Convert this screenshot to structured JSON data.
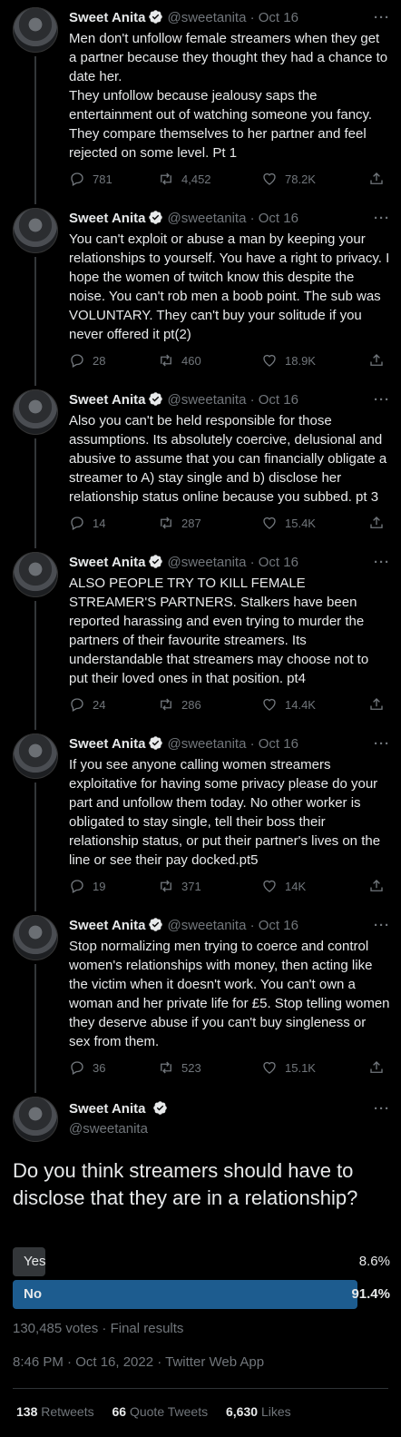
{
  "author": {
    "name": "Sweet Anita",
    "handle": "@sweetanita"
  },
  "colors": {
    "accent": "#1d9bf0",
    "poll_winner": "#1d5c8f",
    "poll_other": "#333639",
    "muted": "#71767b"
  },
  "tweets": [
    {
      "date": "· Oct 16",
      "text": "Men don't unfollow female streamers when they get a partner because they thought they had a chance to date her.\nThey unfollow because jealousy saps the entertainment out of watching someone you fancy. They compare themselves to her partner and feel rejected on some level. Pt 1",
      "replies": "781",
      "retweets": "4,452",
      "likes": "78.2K"
    },
    {
      "date": "· Oct 16",
      "text": "You can't exploit or abuse a man by keeping your relationships to yourself. You have a right to privacy. I hope the women of twitch know this despite the noise. You can't rob men a boob point. The sub was VOLUNTARY. They can't buy your solitude if you never offered it pt(2)",
      "replies": "28",
      "retweets": "460",
      "likes": "18.9K"
    },
    {
      "date": "· Oct 16",
      "text": "Also you can't be held responsible for those assumptions. Its absolutely coercive, delusional and abusive to assume that you can financially obligate a streamer to A) stay single and b) disclose her relationship status online because you subbed. pt 3",
      "replies": "14",
      "retweets": "287",
      "likes": "15.4K"
    },
    {
      "date": "· Oct 16",
      "text": "ALSO PEOPLE TRY TO KILL FEMALE STREAMER'S PARTNERS. Stalkers have been reported harassing and even trying to murder the partners of their favourite streamers. Its understandable that streamers may choose not to put their loved ones in that position. pt4",
      "replies": "24",
      "retweets": "286",
      "likes": "14.4K"
    },
    {
      "date": "· Oct 16",
      "text": "If you see anyone calling women streamers exploitative for having some privacy please do your part and unfollow them today. No other worker is obligated to stay single, tell their boss their relationship status, or put their partner's lives on the line or see their pay docked.pt5",
      "replies": "19",
      "retweets": "371",
      "likes": "14K"
    },
    {
      "date": "· Oct 16",
      "text": "Stop normalizing men trying to coerce and control women's relationships with money, then acting like the victim when it doesn't work. You can't own a woman and her private life for £5. Stop telling women they deserve abuse if you can't buy singleness or sex from them.",
      "replies": "36",
      "retweets": "523",
      "likes": "15.1K"
    }
  ],
  "main": {
    "question": "Do you think streamers should have to disclose that they are in a relationship?",
    "options": [
      {
        "label": "Yes",
        "pct": "8.6%",
        "fraction": 0.086
      },
      {
        "label": "No",
        "pct": "91.4%",
        "fraction": 0.914
      }
    ],
    "votes": "130,485 votes · Final results",
    "timestamp": "8:46 PM · Oct 16, 2022 · Twitter Web App",
    "stats": [
      {
        "count": "138",
        "label": "Retweets"
      },
      {
        "count": "66",
        "label": "Quote Tweets"
      },
      {
        "count": "6,630",
        "label": "Likes"
      }
    ]
  }
}
